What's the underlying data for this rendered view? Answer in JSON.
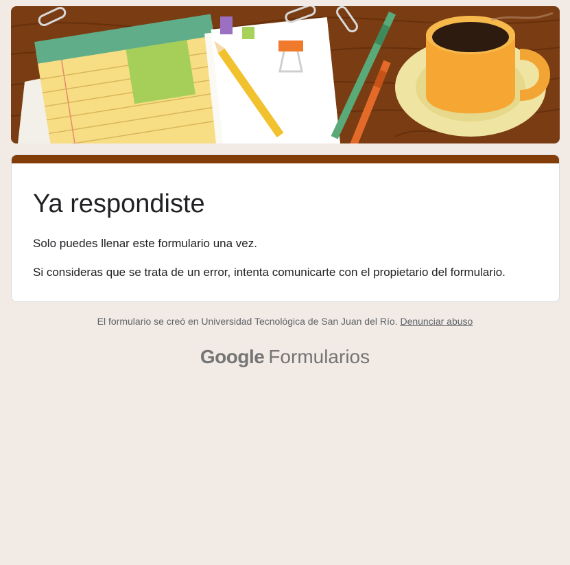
{
  "header": {
    "banner_icon": "desk-illustration"
  },
  "card": {
    "title": "Ya respondiste",
    "line1": "Solo puedes llenar este formulario una vez.",
    "line2": "Si consideras que se trata de un error, intenta comunicarte con el propietario del formulario."
  },
  "footer": {
    "created_text": "El formulario se creó en Universidad Tecnológica de San Juan del Río.",
    "report_link": "Denunciar abuso"
  },
  "brand": {
    "google": "Google",
    "product": "Formularios"
  },
  "colors": {
    "background": "#f1eae5",
    "accent": "#833d08",
    "card": "#ffffff"
  }
}
